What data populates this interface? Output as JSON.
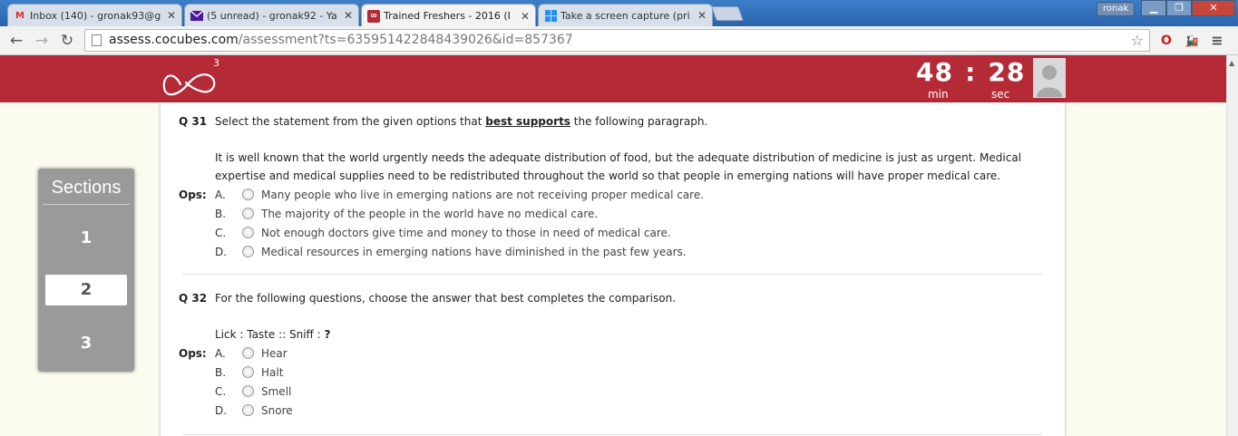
{
  "browser": {
    "tabs": [
      {
        "title": "Inbox (140) - gronak93@g",
        "icon": "gmail-icon",
        "active": false
      },
      {
        "title": "(5 unread) - gronak92 - Ya",
        "icon": "yahoo-mail-icon",
        "active": false
      },
      {
        "title": "Trained Freshers - 2016 (I",
        "icon": "cocubes-icon",
        "active": true
      },
      {
        "title": "Take a screen capture (pri",
        "icon": "windows-icon",
        "active": false
      }
    ],
    "user": "ronak",
    "url_host": "assess.cocubes.com",
    "url_path": "/assessment?ts=635951422848439026&id=857367"
  },
  "header": {
    "logo_sup": "3",
    "timer_minutes": "48",
    "timer_sep": ":",
    "timer_seconds": "28",
    "min_label": "min",
    "sec_label": "sec"
  },
  "sections": {
    "title": "Sections",
    "items": [
      "1",
      "2",
      "3"
    ],
    "active": "2"
  },
  "questions": [
    {
      "number": "Q 31",
      "prompt_pre": "Select the statement from the given options that ",
      "prompt_emph": "best supports",
      "prompt_post": " the following paragraph.",
      "passage": "It is well known that the world urgently needs the adequate distribution of food, but the adequate distribution of medicine is just as urgent. Medical expertise and medical supplies need to be redistributed throughout the world so that people in emerging nations will have proper medical care.",
      "ops_label": "Ops:",
      "options": [
        {
          "letter": "A.",
          "text": "Many people who live in emerging nations are not receiving proper medical care."
        },
        {
          "letter": "B.",
          "text": "The majority of the people in the world have no medical care."
        },
        {
          "letter": "C.",
          "text": "Not enough doctors give time and money to those in need of medical care."
        },
        {
          "letter": "D.",
          "text": "Medical resources in emerging nations have diminished in the past few years."
        }
      ]
    },
    {
      "number": "Q 32",
      "prompt": "For the following questions, choose the answer that best completes the comparison.",
      "analogy_pre": "Lick : Taste :: Sniff : ",
      "analogy_q": "?",
      "ops_label": "Ops:",
      "options": [
        {
          "letter": "A.",
          "text": "Hear"
        },
        {
          "letter": "B.",
          "text": "Halt"
        },
        {
          "letter": "C.",
          "text": "Smell"
        },
        {
          "letter": "D.",
          "text": "Snore"
        }
      ]
    }
  ],
  "colors": {
    "brand_red": "#b52a37",
    "sidebar_gray": "#9a9a9a"
  }
}
